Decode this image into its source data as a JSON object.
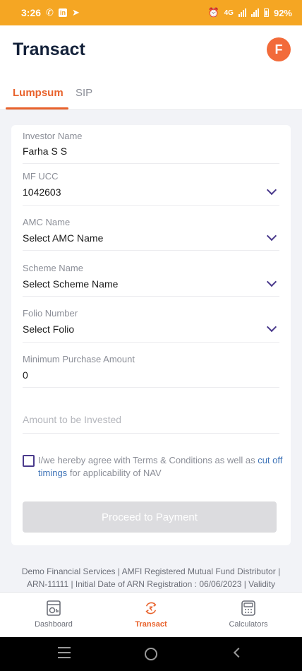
{
  "status_bar": {
    "time": "3:26",
    "network": "4G",
    "battery": "92%"
  },
  "header": {
    "title": "Transact",
    "avatar_initial": "F"
  },
  "tabs": [
    {
      "label": "Lumpsum",
      "active": true
    },
    {
      "label": "SIP",
      "active": false
    }
  ],
  "form": {
    "investor_name": {
      "label": "Investor Name",
      "value": "Farha S S"
    },
    "mf_ucc": {
      "label": "MF UCC",
      "value": "1042603"
    },
    "amc_name": {
      "label": "AMC Name",
      "value": "Select AMC Name"
    },
    "scheme_name": {
      "label": "Scheme Name",
      "value": "Select Scheme Name"
    },
    "folio_number": {
      "label": "Folio Number",
      "value": "Select Folio"
    },
    "min_purchase": {
      "label": "Minimum Purchase Amount",
      "value": "0"
    },
    "amount": {
      "placeholder": "Amount to be Invested",
      "value": ""
    },
    "terms_text_1": "I/we hereby agree with Terms & Conditions as well as",
    "terms_link": "cut off timings",
    "terms_text_2": "for applicability of NAV",
    "terms_checked": false,
    "proceed_label": "Proceed to Payment"
  },
  "footer": {
    "text": "Demo Financial Services | AMFI Registered Mutual Fund Distributor | ARN-11111 | Initial Date of ARN Registration : 06/06/2023 | Validity"
  },
  "bottom_nav": [
    {
      "label": "Dashboard",
      "icon": "dashboard-icon",
      "active": false
    },
    {
      "label": "Transact",
      "icon": "rupee-transfer-icon",
      "active": true
    },
    {
      "label": "Calculators",
      "icon": "calculator-icon",
      "active": false
    }
  ],
  "colors": {
    "accent": "#e8622c",
    "status_bar": "#f5a623",
    "chevron": "#4a3a8c",
    "link": "#3f74b8"
  }
}
